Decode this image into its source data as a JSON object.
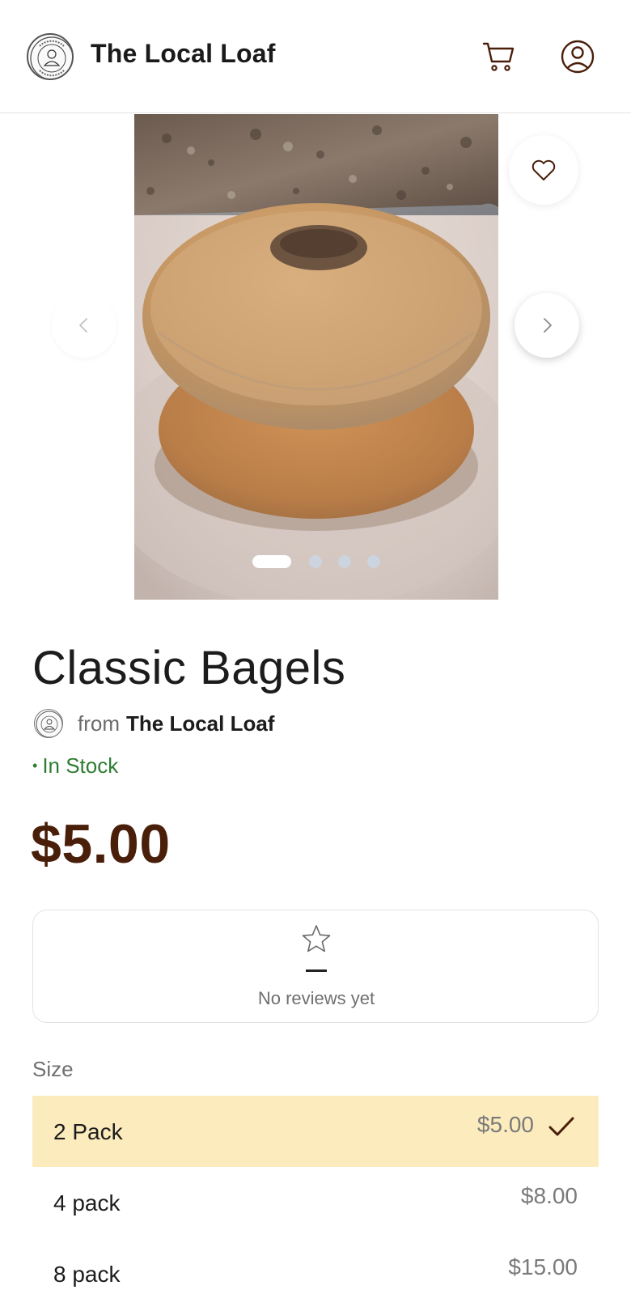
{
  "header": {
    "brand_name": "The Local Loaf",
    "logo_icon": "bakery-seal-logo",
    "cart_icon": "cart-icon",
    "account_icon": "user-account-icon"
  },
  "carousel": {
    "image_alt": "Two stacked bagels on a plate",
    "favorite_icon": "heart-icon",
    "prev_icon": "chevron-left-icon",
    "next_icon": "chevron-right-icon",
    "slide_count": 4,
    "active_slide": 1
  },
  "product": {
    "name": "Classic Bagels",
    "seller_prefix": "from",
    "seller_name": "The Local Loaf",
    "stock_bullet": "•",
    "stock_status": "In Stock",
    "price": "$5.00"
  },
  "reviews": {
    "icon": "star-icon",
    "empty_text": "No reviews yet"
  },
  "size": {
    "label": "Size",
    "options": [
      {
        "label": "2 Pack",
        "price": "$5.00",
        "selected": true
      },
      {
        "label": "4 pack",
        "price": "$8.00",
        "selected": false
      },
      {
        "label": "8 pack",
        "price": "$15.00",
        "selected": false
      }
    ]
  },
  "colors": {
    "brand_brown": "#4a1f0a",
    "in_stock_green": "#2e7d32",
    "selected_option_bg": "#fcebbd"
  }
}
